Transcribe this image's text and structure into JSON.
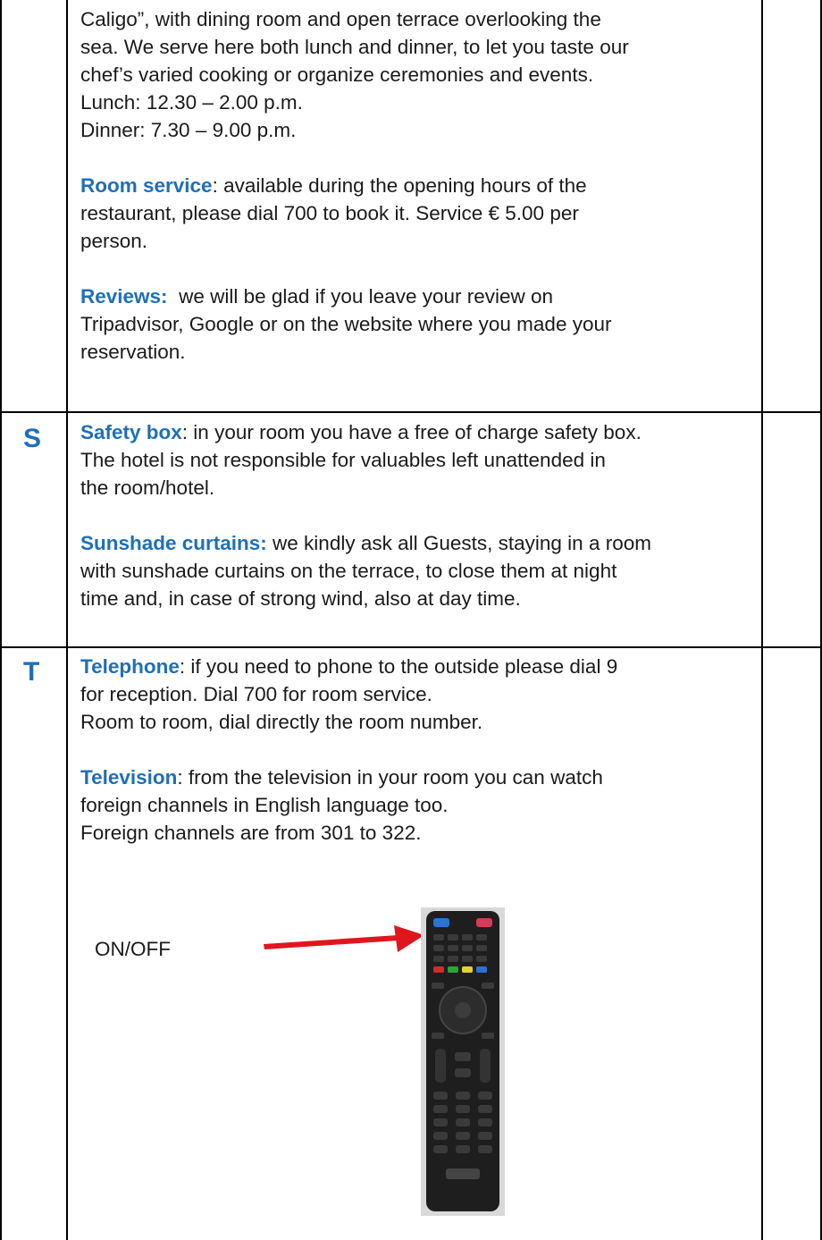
{
  "section_r": {
    "intro_line1": "Caligo”, with dining room and open terrace overlooking the",
    "intro_line2": "sea. We serve here both lunch and dinner, to let you taste our",
    "intro_line3": "chef’s varied cooking or organize ceremonies and events.",
    "lunch": "Lunch: 12.30 – 2.00 p.m.",
    "dinner": "Dinner: 7.30 – 9.00 p.m.",
    "room_service_title": "Room service",
    "room_service_text_line1": ": available during the opening hours of the",
    "room_service_text_line2": "restaurant, please dial 700 to book it. Service € 5.00 per",
    "room_service_text_line3": "person.",
    "reviews_title": "Reviews:",
    "reviews_text_line1": "  we will be glad if you leave your review on",
    "reviews_text_line2": "Tripadvisor, Google or on the website where you made your",
    "reviews_text_line3": "reservation."
  },
  "section_s": {
    "letter": "S",
    "safety_title": "Safety box",
    "safety_line1": ": in your room you have a free of charge safety box.",
    "safety_line2": "The hotel is not responsible for valuables left unattended in",
    "safety_line3": "the room/hotel.",
    "sunshade_title": "Sunshade curtains:",
    "sunshade_line1": " we kindly ask all Guests, staying in a room",
    "sunshade_line2": "with sunshade curtains on the terrace, to close them at night",
    "sunshade_line3": "time and, in case of strong wind, also at day time."
  },
  "section_t": {
    "letter": "T",
    "telephone_title": "Telephone",
    "telephone_line1": ": if you need to phone to the outside please dial 9",
    "telephone_line2": "for reception. Dial 700 for room service.",
    "telephone_line3": "Room to room, dial directly the room number.",
    "television_title": "Television",
    "television_line1": ": from the television in your room you can watch",
    "television_line2": "foreign channels in English language too.",
    "television_line3": "Foreign channels are from 301 to 322.",
    "onoff_label": "ON/OFF"
  },
  "colors": {
    "accent": "#1f6fb8",
    "arrow": "#e0161d",
    "border": "#000000"
  }
}
